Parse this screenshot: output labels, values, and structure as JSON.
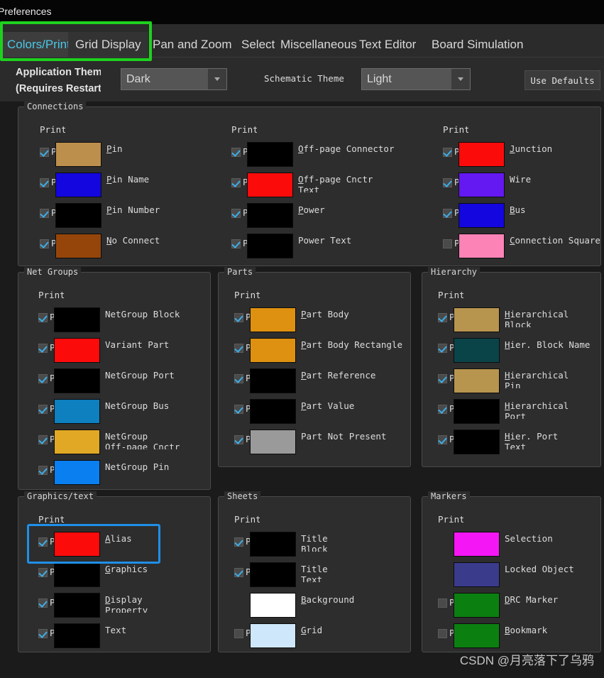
{
  "window": {
    "title": "Preferences"
  },
  "tabs": [
    {
      "label": "Colors/Print",
      "active": true
    },
    {
      "label": "Grid Display",
      "active": false
    },
    {
      "label": "Pan and Zoom",
      "active": false
    },
    {
      "label": "Select",
      "active": false
    },
    {
      "label": "Miscellaneous",
      "active": false
    },
    {
      "label": "Text Editor",
      "active": false
    },
    {
      "label": "Board Simulation",
      "active": false
    }
  ],
  "toolbar": {
    "app_theme_label_line1": "Application Theme",
    "app_theme_label_line2": "(Requires Restart)",
    "app_theme_value": "Dark",
    "schematic_theme_label": "Schematic Theme",
    "schematic_theme_value": "Light",
    "use_defaults_label": "Use Defaults",
    "print_header": "Print"
  },
  "annotations": {
    "tab_box_color": "#1FD11F",
    "alias_box_color": "#1F8FE8"
  },
  "groups": [
    {
      "title": "Connections",
      "columns": [
        {
          "rows": [
            {
              "label": "Pin",
              "underline": "P",
              "color": "#BC8F4C",
              "checked": true,
              "has_checkbox": true
            },
            {
              "label": "Pin Name",
              "underline": "P",
              "color": "#1306DE",
              "checked": true,
              "has_checkbox": true
            },
            {
              "label": "Pin Number",
              "underline": "P",
              "color": "#000000",
              "checked": true,
              "has_checkbox": true
            },
            {
              "label": "No Connect",
              "underline": "N",
              "color": "#96450A",
              "checked": true,
              "has_checkbox": true
            }
          ]
        },
        {
          "rows": [
            {
              "label": "Off-page Connector",
              "underline": "O",
              "color": "#000000",
              "checked": true,
              "has_checkbox": true
            },
            {
              "label": "Off-page Cnctr\nText",
              "underline": "O",
              "color": "#FC0B0B",
              "checked": true,
              "has_checkbox": true
            },
            {
              "label": "Power",
              "underline": "P",
              "color": "#000000",
              "checked": true,
              "has_checkbox": true
            },
            {
              "label": "Power Text",
              "underline": "",
              "color": "#000000",
              "checked": true,
              "has_checkbox": true
            }
          ]
        },
        {
          "rows": [
            {
              "label": "Junction",
              "underline": "J",
              "color": "#FC0B0B",
              "checked": true,
              "has_checkbox": true
            },
            {
              "label": "Wire",
              "underline": "",
              "color": "#6418F2",
              "checked": true,
              "has_checkbox": true
            },
            {
              "label": "Bus",
              "underline": "B",
              "color": "#1306DE",
              "checked": true,
              "has_checkbox": true
            },
            {
              "label": "Connection Square",
              "underline": "C",
              "color": "#FB83B6",
              "checked": false,
              "has_checkbox": true
            }
          ]
        }
      ]
    },
    {
      "title": "Net Groups",
      "columns": [
        {
          "rows": [
            {
              "label": "NetGroup Block",
              "underline": "",
              "color": "#000000",
              "checked": true,
              "has_checkbox": true
            },
            {
              "label": "Variant Part",
              "underline": "",
              "color": "#FC0B0B",
              "checked": true,
              "has_checkbox": true
            },
            {
              "label": "NetGroup Port",
              "underline": "",
              "color": "#000000",
              "checked": true,
              "has_checkbox": true
            },
            {
              "label": "NetGroup Bus",
              "underline": "",
              "color": "#0E7FBF",
              "checked": true,
              "has_checkbox": true
            },
            {
              "label": "NetGroup\nOff-page Cnctr",
              "underline": "",
              "color": "#E0A824",
              "checked": true,
              "has_checkbox": true
            },
            {
              "label": "NetGroup Pin",
              "underline": "",
              "color": "#0A7FEF",
              "checked": true,
              "has_checkbox": true
            }
          ]
        }
      ]
    },
    {
      "title": "Parts",
      "columns": [
        {
          "rows": [
            {
              "label": "Part Body",
              "underline": "P",
              "color": "#DE9110",
              "checked": true,
              "has_checkbox": true
            },
            {
              "label": "Part Body Rectangle",
              "underline": "P",
              "color": "#DE9110",
              "checked": true,
              "has_checkbox": true
            },
            {
              "label": "Part Reference",
              "underline": "P",
              "color": "#000000",
              "checked": true,
              "has_checkbox": true
            },
            {
              "label": "Part Value",
              "underline": "P",
              "color": "#000000",
              "checked": true,
              "has_checkbox": true
            },
            {
              "label": "Part Not Present",
              "underline": "",
              "color": "#9A9A9A",
              "checked": true,
              "has_checkbox": true
            }
          ]
        }
      ]
    },
    {
      "title": "Hierarchy",
      "columns": [
        {
          "rows": [
            {
              "label": "Hierarchical\nBlock",
              "underline": "H",
              "color": "#B8954F",
              "checked": true,
              "has_checkbox": true
            },
            {
              "label": "Hier. Block Name",
              "underline": "H",
              "color": "#0A4448",
              "checked": true,
              "has_checkbox": true
            },
            {
              "label": "Hierarchical\nPin",
              "underline": "H",
              "color": "#B8954F",
              "checked": true,
              "has_checkbox": true
            },
            {
              "label": "Hierarchical\nPort",
              "underline": "H",
              "color": "#000000",
              "checked": true,
              "has_checkbox": true
            },
            {
              "label": "Hier. Port\nText",
              "underline": "H",
              "color": "#000000",
              "checked": true,
              "has_checkbox": true
            }
          ]
        }
      ]
    },
    {
      "title": "Graphics/text",
      "columns": [
        {
          "rows": [
            {
              "label": "Alias",
              "underline": "A",
              "color": "#FC0B0B",
              "checked": true,
              "has_checkbox": true
            },
            {
              "label": "Graphics",
              "underline": "G",
              "color": "#000000",
              "checked": true,
              "has_checkbox": true
            },
            {
              "label": "Display\nProperty",
              "underline": "D",
              "color": "#000000",
              "checked": true,
              "has_checkbox": true
            },
            {
              "label": "Text",
              "underline": "",
              "color": "#000000",
              "checked": true,
              "has_checkbox": true
            }
          ]
        }
      ]
    },
    {
      "title": "Sheets",
      "columns": [
        {
          "rows": [
            {
              "label": "Title\nBlock",
              "underline": "",
              "color": "#000000",
              "checked": true,
              "has_checkbox": true
            },
            {
              "label": "Title\nText",
              "underline": "",
              "color": "#000000",
              "checked": true,
              "has_checkbox": true
            },
            {
              "label": "Background",
              "underline": "B",
              "color": "#FFFFFF",
              "checked": false,
              "has_checkbox": false
            },
            {
              "label": "Grid",
              "underline": "G",
              "color": "#CFE7FA",
              "checked": false,
              "has_checkbox": true
            }
          ]
        }
      ]
    },
    {
      "title": "Markers",
      "columns": [
        {
          "rows": [
            {
              "label": "Selection",
              "underline": "",
              "color": "#F516F5",
              "checked": false,
              "has_checkbox": false
            },
            {
              "label": "Locked Object",
              "underline": "",
              "color": "#3B3B8C",
              "checked": false,
              "has_checkbox": false
            },
            {
              "label": "DRC Marker",
              "underline": "D",
              "color": "#0B8011",
              "checked": false,
              "has_checkbox": true
            },
            {
              "label": "Bookmark",
              "underline": "B",
              "color": "#0B8011",
              "checked": false,
              "has_checkbox": true
            }
          ]
        }
      ]
    }
  ],
  "watermark": "CSDN @月亮落下了乌鸦"
}
